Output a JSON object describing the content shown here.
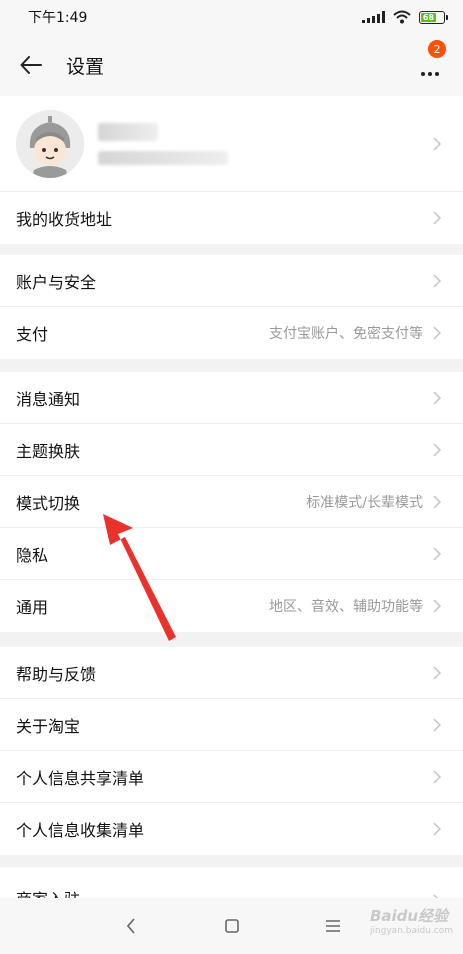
{
  "status_bar": {
    "time": "下午1:49",
    "battery_level": "68",
    "battery_color": "#58c11a"
  },
  "header": {
    "title": "设置",
    "badge_count": "2"
  },
  "profile": {
    "name_blurred": true
  },
  "groups": [
    {
      "rows": [
        {
          "label": "我的收货地址",
          "value": ""
        }
      ]
    },
    {
      "rows": [
        {
          "label": "账户与安全",
          "value": ""
        },
        {
          "label": "支付",
          "value": "支付宝账户、免密支付等"
        }
      ]
    },
    {
      "rows": [
        {
          "label": "消息通知",
          "value": ""
        },
        {
          "label": "主题换肤",
          "value": ""
        },
        {
          "label": "模式切换",
          "value": "标准模式/长辈模式"
        },
        {
          "label": "隐私",
          "value": ""
        },
        {
          "label": "通用",
          "value": "地区、音效、辅助功能等"
        }
      ]
    },
    {
      "rows": [
        {
          "label": "帮助与反馈",
          "value": ""
        },
        {
          "label": "关于淘宝",
          "value": ""
        },
        {
          "label": "个人信息共享清单",
          "value": ""
        },
        {
          "label": "个人信息收集清单",
          "value": ""
        }
      ]
    },
    {
      "rows": [
        {
          "label": "商家入驻",
          "value": ""
        }
      ]
    }
  ],
  "watermark": {
    "brand": "Baidu经验",
    "url": "jingyan.baidu.com"
  },
  "colors": {
    "accent": "#ff5000",
    "annotation_arrow": "#e8322b"
  }
}
